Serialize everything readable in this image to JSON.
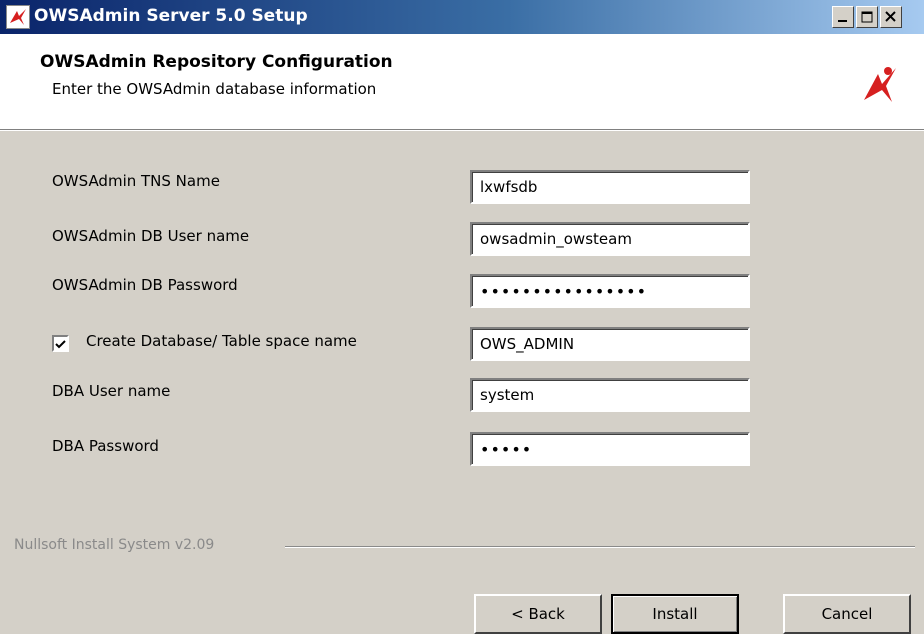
{
  "window": {
    "title": "OWSAdmin Server 5.0 Setup"
  },
  "header": {
    "title": "OWSAdmin Repository Configuration",
    "subtitle": "Enter the OWSAdmin database information"
  },
  "form": {
    "tns_label": "OWSAdmin TNS Name",
    "tns_value": "lxwfsdb",
    "dbuser_label": "OWSAdmin DB User name",
    "dbuser_value": "owsadmin_owsteam",
    "dbpass_label": "OWSAdmin DB Password",
    "dbpass_value": "••••••••••••••••",
    "create_db_label": "Create Database/ Table space name",
    "create_db_checked": true,
    "tablespace_value": "OWS_ADMIN",
    "dba_user_label": "DBA User name",
    "dba_user_value": "system",
    "dba_pass_label": "DBA Password",
    "dba_pass_value": "•••••"
  },
  "footer": {
    "branding": "Nullsoft Install System v2.09",
    "back_label": "< Back",
    "install_label": "Install",
    "cancel_label": "Cancel"
  },
  "colors": {
    "titlebar": "#0a246a",
    "face": "#d4d0c8",
    "logo": "#d62020"
  }
}
